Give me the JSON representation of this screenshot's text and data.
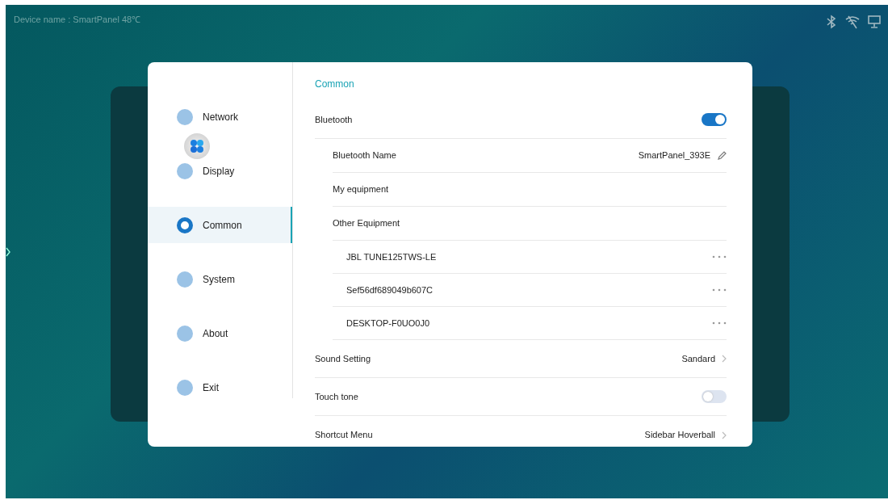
{
  "status_bar": {
    "device_info": "Device name : SmartPanel   48℃"
  },
  "sidebar": {
    "items": [
      {
        "label": "Network",
        "selected": false
      },
      {
        "label": "Display",
        "selected": false
      },
      {
        "label": "Common",
        "selected": true
      },
      {
        "label": "System",
        "selected": false
      },
      {
        "label": "About",
        "selected": false
      },
      {
        "label": "Exit",
        "selected": false
      }
    ]
  },
  "content": {
    "title": "Common",
    "rows": [
      {
        "kind": "toggle",
        "label": "Bluetooth",
        "on": true,
        "children": [
          {
            "kind": "edit",
            "label": "Bluetooth Name",
            "value": "SmartPanel_393E"
          },
          {
            "kind": "plain",
            "label": "My equipment"
          },
          {
            "kind": "plain",
            "label": "Other Equipment",
            "children": [
              {
                "kind": "device",
                "label": "JBL TUNE125TWS-LE"
              },
              {
                "kind": "device",
                "label": "Sef56df689049b607C"
              },
              {
                "kind": "device",
                "label": "DESKTOP-F0UO0J0"
              }
            ]
          }
        ]
      },
      {
        "kind": "link",
        "label": "Sound Setting",
        "value": "Sandard"
      },
      {
        "kind": "toggle",
        "label": "Touch tone",
        "on": false
      },
      {
        "kind": "link",
        "label": "Shortcut Menu",
        "value": "Sidebar Hoverball"
      }
    ]
  }
}
